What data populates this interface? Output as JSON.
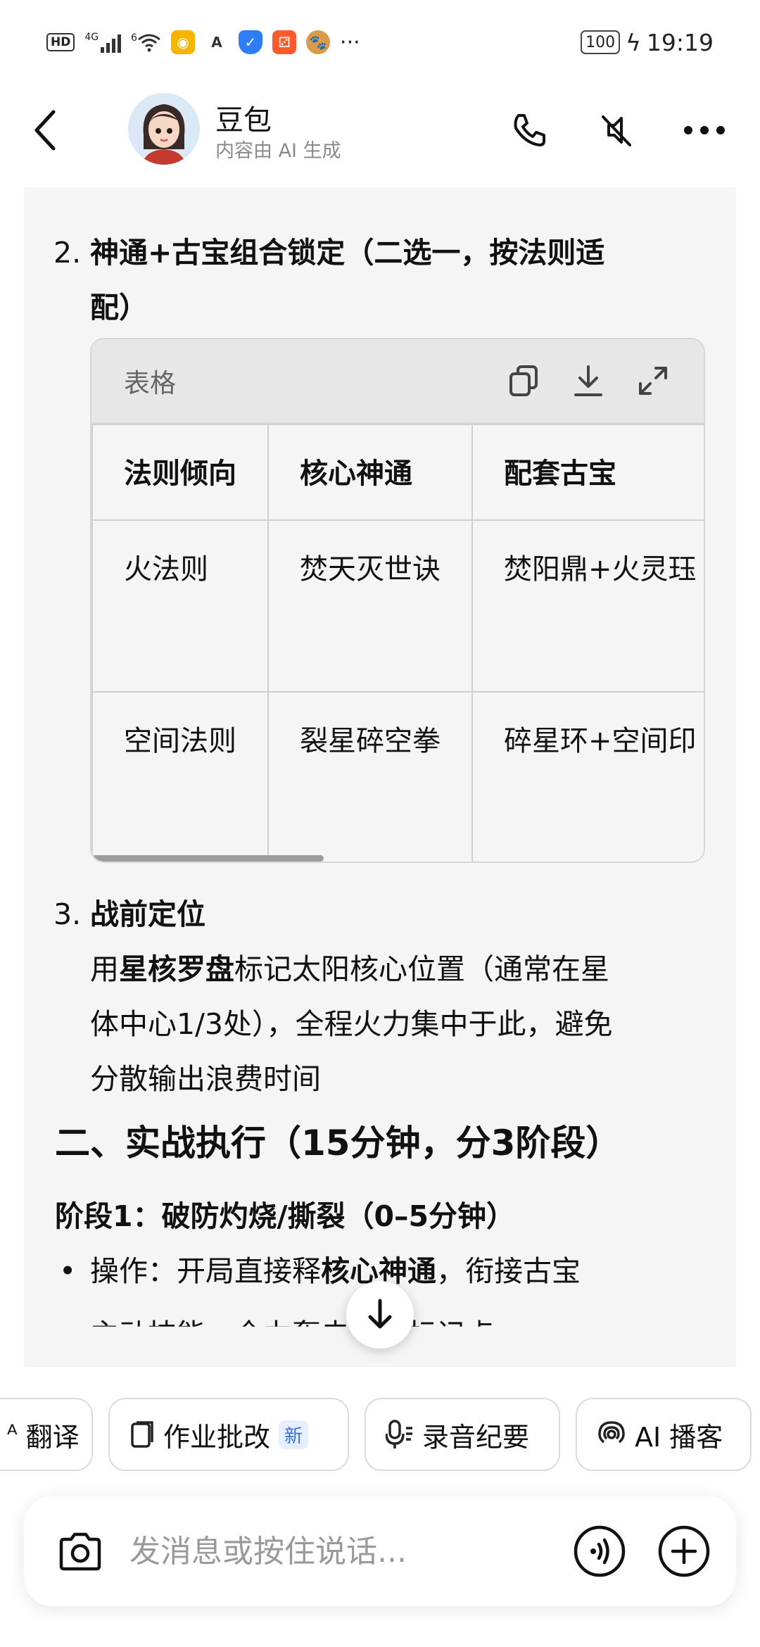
{
  "status_bar": {
    "network_label": "HD",
    "signal_label": "4G",
    "wifi_label": "6",
    "more": "···",
    "battery": "100",
    "time": "19:19"
  },
  "header": {
    "name": "豆包",
    "subtitle": "内容由 AI 生成"
  },
  "content": {
    "item2": {
      "number": "2.",
      "title_line1": "神通+古宝组合锁定（二选一，按法则适",
      "title_line2": "配）"
    },
    "table": {
      "label": "表格",
      "columns": [
        "法则倾向",
        "核心神通",
        "配套古宝"
      ],
      "rows": [
        [
          "火法则",
          "焚天灭世诀",
          "焚阳鼎+火灵珏"
        ],
        [
          "空间法则",
          "裂星碎空拳",
          "碎星环+空间印"
        ]
      ]
    },
    "item3": {
      "number": "3.",
      "title": "战前定位",
      "line1_prefix": "用",
      "line1_bold": "星核罗盘",
      "line1_suffix": "标记太阳核心位置（通常在星",
      "line2": "体中心1/3处），全程火力集中于此，避免",
      "line3": "分散输出浪费时间"
    },
    "section_title": "二、实战执行（15分钟，分3阶段）",
    "stage_title": "阶段1：破防灼烧/撕裂（0–5分钟）",
    "bullet": {
      "prefix": "操作：开局直接释",
      "bold": "核心神通",
      "suffix": "，衔接古宝"
    },
    "bullet_cont": "主动技能，全力轰击星核标记点"
  },
  "chips": [
    {
      "label": "翻译",
      "icon": "translate-icon"
    },
    {
      "label": "作业批改",
      "icon": "homework-icon",
      "badge": "新"
    },
    {
      "label": "录音纪要",
      "icon": "mic-icon"
    },
    {
      "label": "AI 播客",
      "icon": "podcast-icon"
    }
  ],
  "input": {
    "placeholder": "发消息或按住说话..."
  }
}
